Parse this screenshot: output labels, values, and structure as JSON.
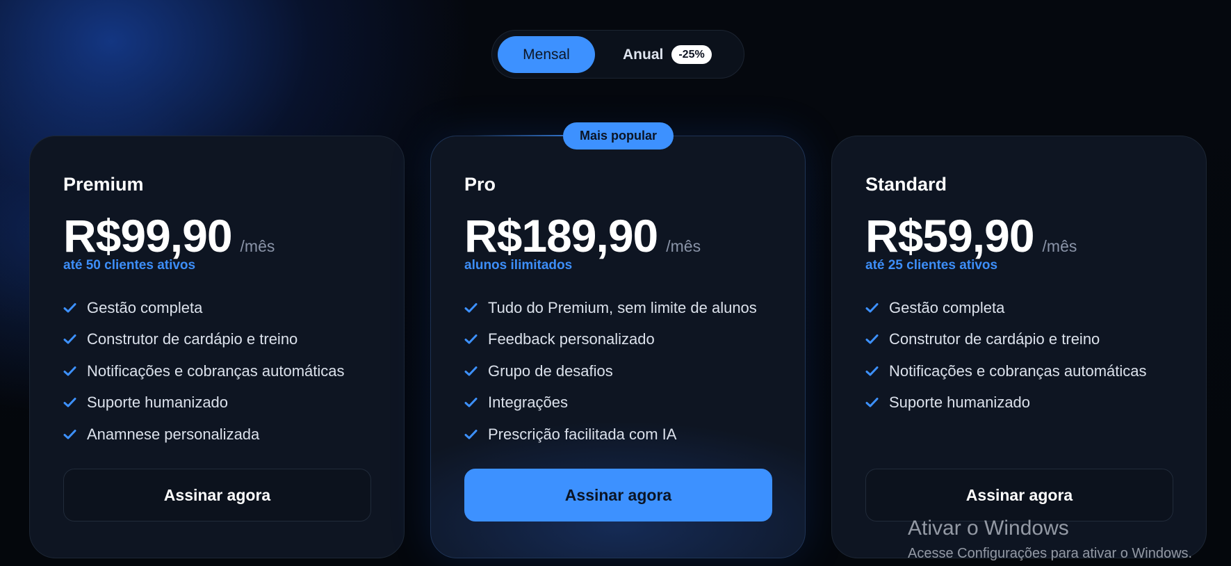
{
  "billing_toggle": {
    "monthly_label": "Mensal",
    "annual_label": "Anual",
    "annual_discount": "-25%",
    "selected": "Mensal"
  },
  "accent_color": "#3d91ff",
  "plans": [
    {
      "name": "Premium",
      "price": "R$99,90",
      "period": "/mês",
      "subtitle": "até 50 clientes ativos",
      "features": [
        "Gestão completa",
        "Construtor de cardápio e treino",
        "Notificações e cobranças automáticas",
        "Suporte humanizado",
        "Anamnese personalizada"
      ],
      "cta": "Assinar agora"
    },
    {
      "name": "Pro",
      "badge": "Mais popular",
      "price": "R$189,90",
      "period": "/mês",
      "subtitle": "alunos ilimitados",
      "features": [
        "Tudo do Premium, sem limite de alunos",
        "Feedback personalizado",
        "Grupo de desafios",
        "Integrações",
        "Prescrição facilitada com IA"
      ],
      "cta": "Assinar agora"
    },
    {
      "name": "Standard",
      "price": "R$59,90",
      "period": "/mês",
      "subtitle": "até 25 clientes ativos",
      "features": [
        "Gestão completa",
        "Construtor de cardápio e treino",
        "Notificações e cobranças automáticas",
        "Suporte humanizado"
      ],
      "cta": "Assinar agora"
    }
  ],
  "check_icon": "check-icon",
  "windows_watermark": {
    "title": "Ativar o Windows",
    "subtitle": "Acesse Configurações para ativar o Windows."
  }
}
